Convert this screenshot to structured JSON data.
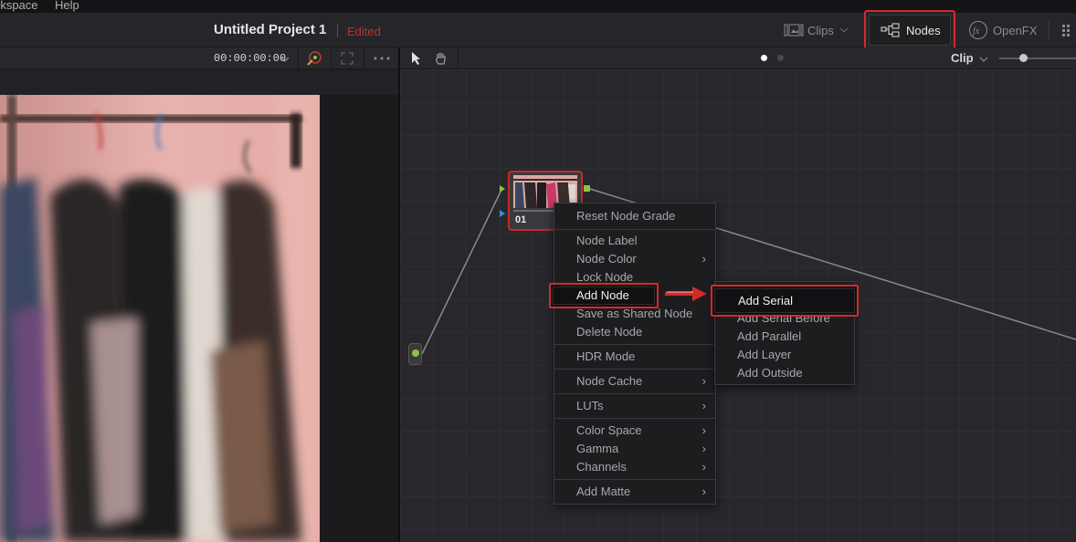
{
  "menubar": {
    "items": [
      "rkspace",
      "Help"
    ]
  },
  "titlebar": {
    "project_title": "Untitled Project 1",
    "status": "Edited",
    "clips_label": "Clips",
    "nodes_label": "Nodes",
    "openfx_label": "OpenFX"
  },
  "viewer": {
    "timecode": "00:00:00:00"
  },
  "node_editor": {
    "mode_label": "Clip",
    "node_number": "01"
  },
  "context_menu": {
    "items": [
      "Reset Node Grade",
      "Node Label",
      "Node Color",
      "Lock Node",
      "Add Node",
      "Save as Shared Node",
      "Delete Node",
      "HDR Mode",
      "Node Cache",
      "LUTs",
      "Color Space",
      "Gamma",
      "Channels",
      "Add Matte"
    ]
  },
  "submenu": {
    "items": [
      "Add Serial",
      "Add Serial Before",
      "Add Parallel",
      "Add Layer",
      "Add Outside"
    ]
  },
  "colors": {
    "highlight": "#d52a2a",
    "edited": "#c0302b",
    "node_connector": "#8fc23c"
  }
}
